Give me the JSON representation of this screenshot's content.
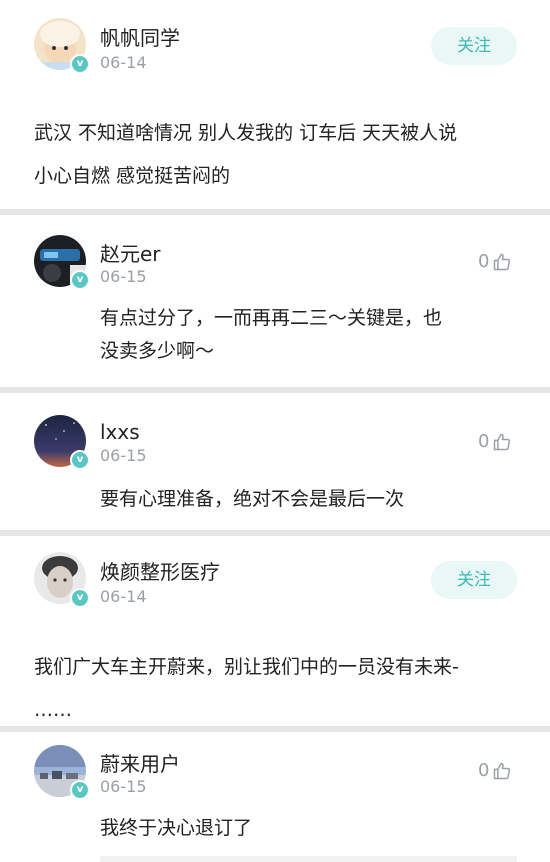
{
  "posts": [
    {
      "name": "帆帆同学",
      "date": "06-14",
      "follow": "关注",
      "lines": [
        "武汉 不知道啥情况 别人发我的 订车后 天天被人说",
        "小心自燃 感觉挺苦闷的"
      ]
    },
    {
      "name": "焕颜整形医疗",
      "date": "06-14",
      "follow": "关注",
      "lines": [
        "我们广大车主开蔚来，别让我们中的一员没有未来-",
        "……"
      ]
    }
  ],
  "comments": [
    {
      "name": "赵元er",
      "date": "06-15",
      "likes": "0",
      "lines": [
        "有点过分了，一而再再二三～关键是，也",
        "没卖多少啊～"
      ]
    },
    {
      "name": "lxxs",
      "date": "06-15",
      "likes": "0",
      "lines": [
        "要有心理准备，绝对不会是最后一次"
      ]
    },
    {
      "name": "蔚来用户",
      "date": "06-15",
      "likes": "0",
      "lines": [
        "我终于决心退订了"
      ]
    }
  ],
  "icons": {
    "verified": "verified-badge-icon",
    "like": "thumbs-up-icon"
  },
  "colors": {
    "accent": "#3fb9b3",
    "follow_bg": "#e9f7f6",
    "verified": "#5bc7c4",
    "separator": "#e6e6e6"
  }
}
